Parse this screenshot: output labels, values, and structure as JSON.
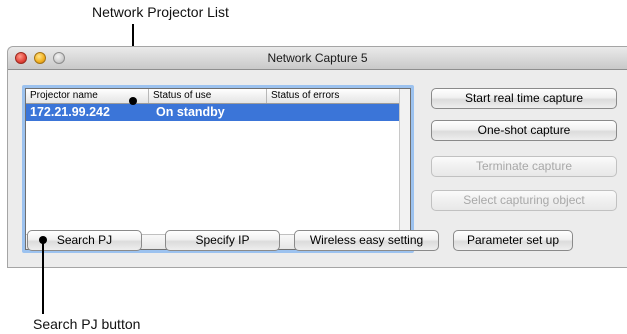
{
  "callouts": {
    "top": "Network Projector List",
    "bottom": "Search PJ button"
  },
  "window": {
    "title": "Network Capture 5",
    "controls": [
      "close",
      "minimize",
      "zoom"
    ]
  },
  "projector_list": {
    "columns": [
      "Projector name",
      "Status of use",
      "Status of errors"
    ],
    "rows": [
      {
        "name": "172.21.99.242",
        "status_use": "On standby",
        "status_errors": ""
      }
    ]
  },
  "buttons": {
    "start_realtime": "Start real time capture",
    "one_shot": "One-shot capture",
    "terminate": "Terminate capture",
    "select_object": "Select capturing object",
    "search_pj": "Search PJ",
    "specify_ip": "Specify IP",
    "wireless_easy": "Wireless easy setting",
    "parameter_setup": "Parameter set up"
  },
  "colors": {
    "selection": "#3b75d8",
    "focus_ring": "#9cc2ef"
  }
}
